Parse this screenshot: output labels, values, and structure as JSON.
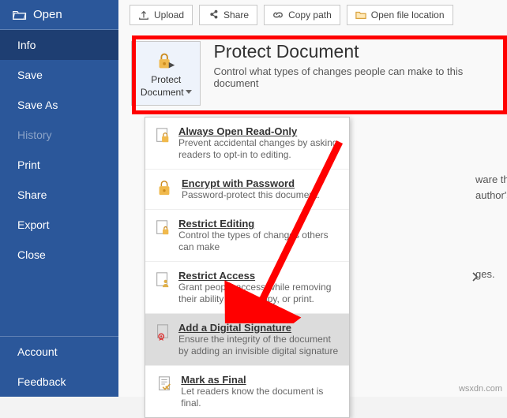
{
  "sidebar": {
    "open_label": "Open",
    "items": [
      "Info",
      "Save",
      "Save As",
      "History",
      "Print",
      "Share",
      "Export",
      "Close"
    ],
    "bottom": [
      "Account",
      "Feedback"
    ]
  },
  "toolbar": {
    "upload": "Upload",
    "share": "Share",
    "copy_path": "Copy path",
    "open_location": "Open file location"
  },
  "protect": {
    "title": "Protect Document",
    "desc": "Control what types of changes people can make to this document",
    "btn_line1": "Protect",
    "btn_line2": "Document"
  },
  "menu": [
    {
      "t": "Always Open Read-Only",
      "d": "Prevent accidental changes by asking readers to opt-in to editing."
    },
    {
      "t": "Encrypt with Password",
      "d": "Password-protect this document."
    },
    {
      "t": "Restrict Editing",
      "d": "Control the types of changes others can make"
    },
    {
      "t": "Restrict Access",
      "d": "Grant people access while removing their ability to edit, copy, or print."
    },
    {
      "t": "Add a Digital Signature",
      "d": "Ensure the integrity of the document by adding an invisible digital signature"
    },
    {
      "t": "Mark as Final",
      "d": "Let readers know the document is final."
    }
  ],
  "bg": {
    "line1": "ware that it contains:",
    "line2": "author's name",
    "line3": "ges."
  },
  "watermark": "wsxdn.com"
}
